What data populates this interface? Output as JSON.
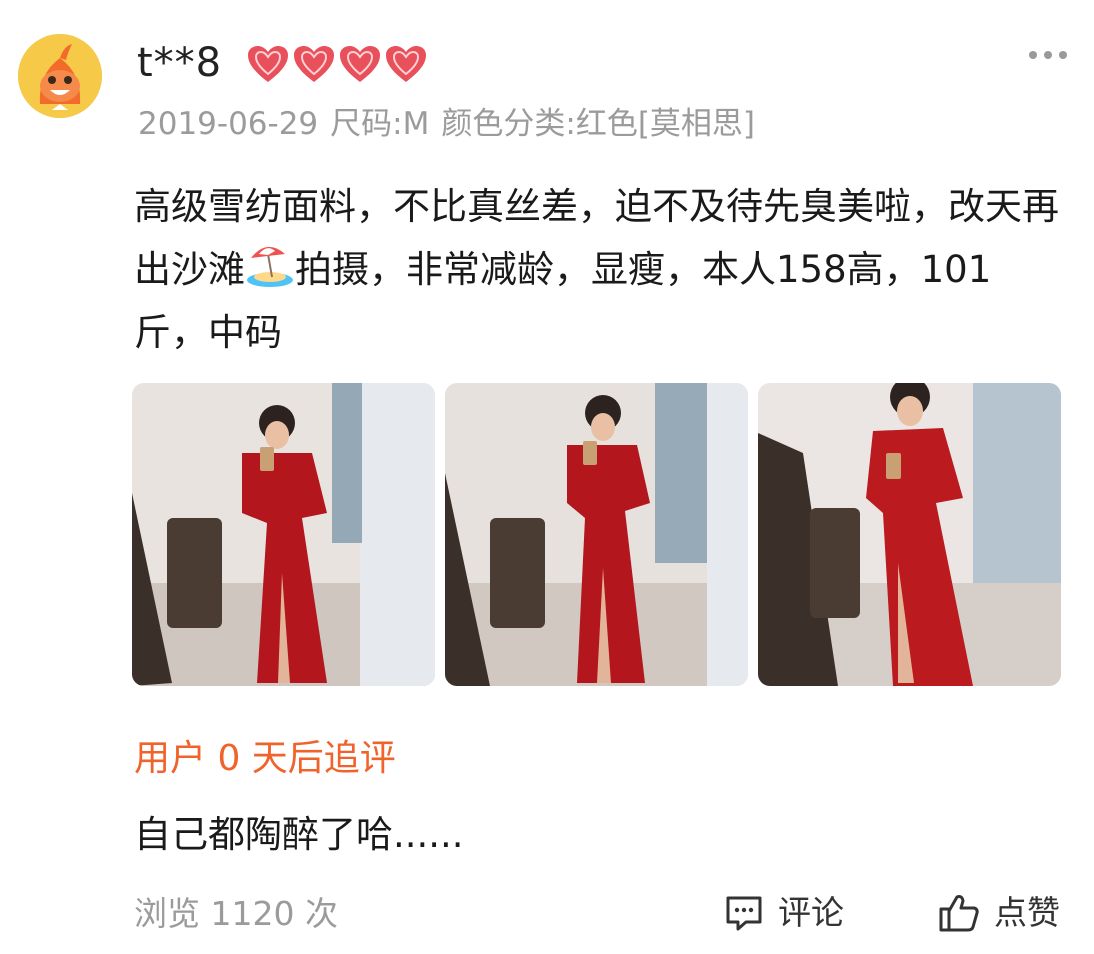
{
  "review": {
    "user": {
      "name": "t**8",
      "avatar_icon": "mascot-avatar-icon",
      "level_icons": [
        "heart-icon",
        "heart-icon",
        "heart-icon",
        "heart-icon"
      ]
    },
    "date": "2019-06-29",
    "size": "尺码:M",
    "color_category": "颜色分类:红色[莫相思]",
    "text_part1": "高级雪纺面料，不比真丝差，迫不及待先臭美啦，改天再出沙滩",
    "emoji_icon": "beach-umbrella-icon",
    "text_part2": "拍摄，非常减龄，显瘦，本人158高，101斤，中码",
    "photos": [
      {
        "alt": "red-dress-mirror-selfie-1"
      },
      {
        "alt": "red-dress-mirror-selfie-2"
      },
      {
        "alt": "red-dress-mirror-selfie-3"
      }
    ],
    "followup_label": "用户 0 天后追评",
    "followup_text": "自己都陶醉了哈......",
    "views": "浏览 1120 次",
    "comment_label": "评论",
    "like_label": "点赞"
  },
  "colors": {
    "accent": "#f0632a",
    "meta_gray": "#9b9b9b",
    "heart": "#e8505b"
  }
}
